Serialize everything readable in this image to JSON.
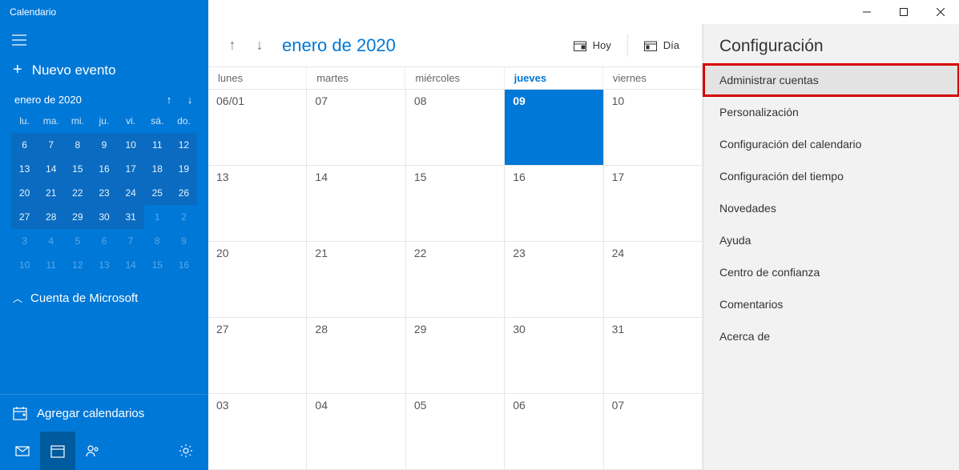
{
  "title": "Calendario",
  "sidebar": {
    "new_event": "Nuevo evento",
    "month_label": "enero de 2020",
    "weekday_short": [
      "lu.",
      "ma.",
      "mi.",
      "ju.",
      "vi.",
      "sá.",
      "do."
    ],
    "mini_weeks": [
      [
        {
          "d": "6"
        },
        {
          "d": "7"
        },
        {
          "d": "8"
        },
        {
          "d": "9",
          "sel": true
        },
        {
          "d": "10"
        },
        {
          "d": "11"
        },
        {
          "d": "12"
        }
      ],
      [
        {
          "d": "13"
        },
        {
          "d": "14"
        },
        {
          "d": "15"
        },
        {
          "d": "16"
        },
        {
          "d": "17"
        },
        {
          "d": "18"
        },
        {
          "d": "19"
        }
      ],
      [
        {
          "d": "20"
        },
        {
          "d": "21"
        },
        {
          "d": "22"
        },
        {
          "d": "23"
        },
        {
          "d": "24"
        },
        {
          "d": "25"
        },
        {
          "d": "26"
        }
      ],
      [
        {
          "d": "27"
        },
        {
          "d": "28"
        },
        {
          "d": "29"
        },
        {
          "d": "30"
        },
        {
          "d": "31"
        },
        {
          "d": "1",
          "dim": true
        },
        {
          "d": "2",
          "dim": true
        }
      ],
      [
        {
          "d": "3",
          "dim": true
        },
        {
          "d": "4",
          "dim": true
        },
        {
          "d": "5",
          "dim": true
        },
        {
          "d": "6",
          "dim": true
        },
        {
          "d": "7",
          "dim": true
        },
        {
          "d": "8",
          "dim": true
        },
        {
          "d": "9",
          "dim": true
        }
      ],
      [
        {
          "d": "10",
          "dim": true
        },
        {
          "d": "11",
          "dim": true
        },
        {
          "d": "12",
          "dim": true
        },
        {
          "d": "13",
          "dim": true
        },
        {
          "d": "14",
          "dim": true
        },
        {
          "d": "15",
          "dim": true
        },
        {
          "d": "16",
          "dim": true
        }
      ]
    ],
    "account_label": "Cuenta de Microsoft",
    "add_calendars": "Agregar calendarios"
  },
  "main": {
    "month_title": "enero de 2020",
    "today_btn": "Hoy",
    "view_btn": "Día",
    "weekdays": [
      {
        "label": "lunes"
      },
      {
        "label": "martes"
      },
      {
        "label": "miércoles"
      },
      {
        "label": "jueves",
        "today": true
      },
      {
        "label": "viernes"
      }
    ],
    "weeks": [
      [
        {
          "d": "06/01"
        },
        {
          "d": "07"
        },
        {
          "d": "08"
        },
        {
          "d": "09",
          "today": true
        },
        {
          "d": "10"
        }
      ],
      [
        {
          "d": "13"
        },
        {
          "d": "14"
        },
        {
          "d": "15"
        },
        {
          "d": "16"
        },
        {
          "d": "17"
        }
      ],
      [
        {
          "d": "20"
        },
        {
          "d": "21"
        },
        {
          "d": "22"
        },
        {
          "d": "23"
        },
        {
          "d": "24"
        }
      ],
      [
        {
          "d": "27"
        },
        {
          "d": "28"
        },
        {
          "d": "29"
        },
        {
          "d": "30"
        },
        {
          "d": "31"
        }
      ],
      [
        {
          "d": "03"
        },
        {
          "d": "04"
        },
        {
          "d": "05"
        },
        {
          "d": "06"
        },
        {
          "d": "07"
        }
      ]
    ]
  },
  "settings": {
    "title": "Configuración",
    "items": [
      {
        "label": "Administrar cuentas",
        "highlight": true
      },
      {
        "label": "Personalización"
      },
      {
        "label": "Configuración del calendario"
      },
      {
        "label": "Configuración del tiempo"
      },
      {
        "label": "Novedades"
      },
      {
        "label": "Ayuda"
      },
      {
        "label": "Centro de confianza"
      },
      {
        "label": "Comentarios"
      },
      {
        "label": "Acerca de"
      }
    ]
  }
}
